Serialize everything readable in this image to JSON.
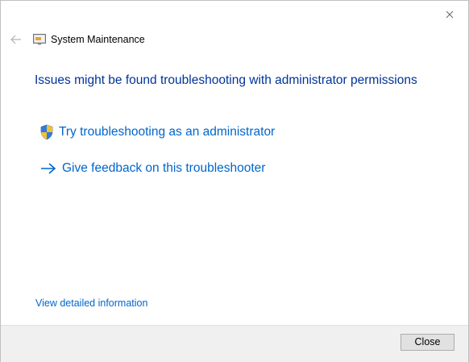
{
  "window": {
    "app_title": "System Maintenance"
  },
  "main": {
    "heading": "Issues might be found troubleshooting with administrator permissions",
    "options": [
      {
        "label": "Try troubleshooting as an administrator",
        "icon": "uac-shield-icon"
      },
      {
        "label": "Give feedback on this troubleshooter",
        "icon": "arrow-right-icon"
      }
    ],
    "details_link": "View detailed information"
  },
  "footer": {
    "close_label": "Close"
  },
  "colors": {
    "heading": "#003399",
    "link": "#0066cc",
    "footer_bg": "#f0f0f0",
    "button_bg": "#e1e1e1"
  }
}
